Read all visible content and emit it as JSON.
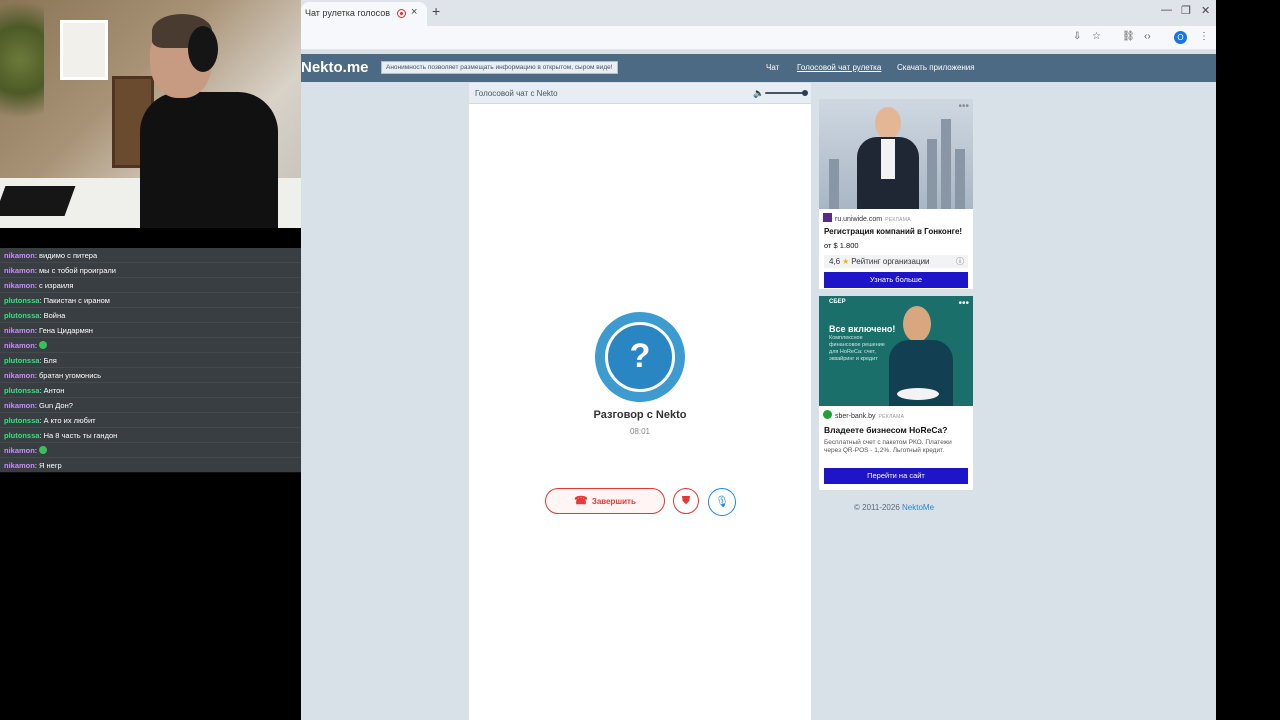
{
  "browser": {
    "tab_title": "Чат рулетка голосов",
    "tab_close": "×",
    "new_tab": "+",
    "profile_initial": "О"
  },
  "site": {
    "logo": "Nekto.me",
    "notice": "Анонимность позволяет размещать информацию в открытом, сыром виде!",
    "nav": [
      "Чат",
      "Голосовой чат рулетка",
      "Скачать приложения"
    ],
    "active_nav": "Голосовой чат рулетка"
  },
  "chat": {
    "title": "Голосовой чат с Nekto",
    "avatar_symbol": "?",
    "caller": "Разговор с Nekto",
    "timer": "08:01",
    "end_label": "Завершить"
  },
  "ads": [
    {
      "domain": "ru.uniwide.com",
      "tag": "РЕКЛАМА",
      "title": "Регистрация компаний в Гонконге!",
      "price": "от $ 1.800",
      "rating": "4,6",
      "rating_label": "Рейтинг организации",
      "cta": "Узнать больше"
    },
    {
      "brand": "СБЕР",
      "headline": "Все включено!",
      "subtext": "Комплексное финансовое решение для HoReCa: счет, эквайринг и кредит",
      "domain": "sber-bank.by",
      "tag": "РЕКЛАМА",
      "title": "Владеете бизнесом HoReCa?",
      "text": "Бесплатный счет с пакетом РКО. Платежи через QR-POS - 1,2%. Льготный кредит.",
      "cta": "Перейти на сайт"
    }
  ],
  "footer": {
    "copyright": "© 2011-2026",
    "link": "NektoMe"
  },
  "stream_chat": [
    {
      "user": "nikamon",
      "msg": ": видимо с питера"
    },
    {
      "user": "nikamon",
      "msg": ": мы с тобой проиграли"
    },
    {
      "user": "nikamon",
      "msg": ": с израиля"
    },
    {
      "user": "plutonssa",
      "msg": ": Пакистан с ираном"
    },
    {
      "user": "plutonssa",
      "msg": ": Война"
    },
    {
      "user": "nikamon",
      "msg": ": Гена Цидармян"
    },
    {
      "user": "nikamon",
      "msg": ":"
    },
    {
      "user": "plutonssa",
      "msg": ": Бля"
    },
    {
      "user": "nikamon",
      "msg": ": братан угомонись"
    },
    {
      "user": "plutonssa",
      "msg": ": Антон"
    },
    {
      "user": "nikamon",
      "msg": ": Gun Дон?"
    },
    {
      "user": "plutonssa",
      "msg": ": А кто их любит"
    },
    {
      "user": "plutonssa",
      "msg": ": На 8 часть ты гандон"
    },
    {
      "user": "nikamon",
      "msg": ":"
    },
    {
      "user": "nikamon",
      "msg": ": Я негр"
    }
  ],
  "colors": {
    "header_bg": "#4d6a84",
    "page_bg": "#d7e1e7",
    "accent_blue": "#2a86c2",
    "end_red": "#e53935",
    "cta_blue": "#1e14c8",
    "nikamon": "#c88bff",
    "plutonssa": "#38e07e"
  }
}
